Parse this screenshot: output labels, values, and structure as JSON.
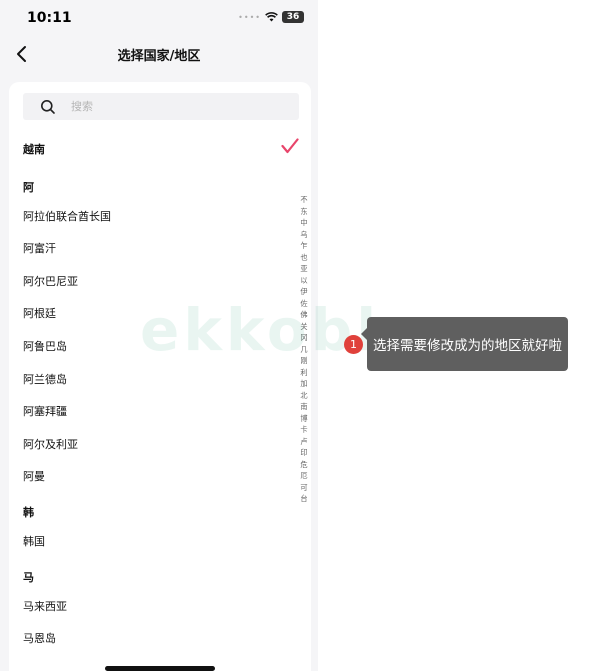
{
  "status_bar": {
    "time": "10:11",
    "battery": "36"
  },
  "nav": {
    "title": "选择国家/地区"
  },
  "search": {
    "placeholder": "搜索"
  },
  "selected": {
    "label": "越南"
  },
  "sections": [
    {
      "header": "阿",
      "items": [
        "阿拉伯联合酋长国",
        "阿富汗",
        "阿尔巴尼亚",
        "阿根廷",
        "阿鲁巴岛",
        "阿兰德岛",
        "阿塞拜疆",
        "阿尔及利亚",
        "阿曼"
      ]
    },
    {
      "header": "韩",
      "items": [
        "韩国"
      ]
    },
    {
      "header": "马",
      "items": [
        "马来西亚",
        "马恩岛"
      ]
    }
  ],
  "index_letters": [
    "不",
    "东",
    "中",
    "乌",
    "乍",
    "也",
    "亚",
    "以",
    "伊",
    "佐",
    "佛",
    "关",
    "冈",
    "几",
    "刚",
    "利",
    "加",
    "北",
    "南",
    "博",
    "卡",
    "卢",
    "印",
    "危",
    "厄",
    "可",
    "台"
  ],
  "watermark": "ekkoblog",
  "callout": {
    "badge": "1",
    "text": "选择需要修改成为的地区就好啦"
  },
  "colors": {
    "accent": "#e8456b",
    "callout_bg": "#5f5f5f",
    "badge": "#e0413b"
  }
}
